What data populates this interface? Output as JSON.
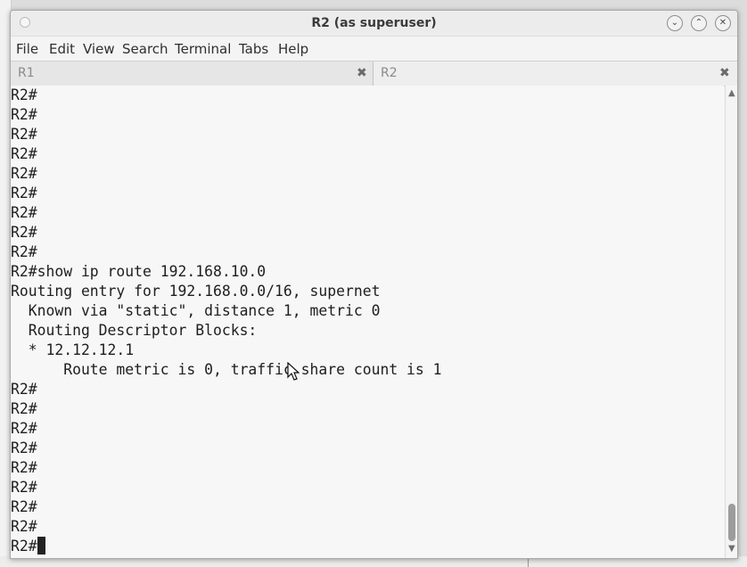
{
  "window": {
    "title": "R2 (as superuser)"
  },
  "menu": [
    "File",
    "Edit",
    "View",
    "Search",
    "Terminal",
    "Tabs",
    "Help"
  ],
  "tabs": [
    {
      "label": "R1",
      "close": "✖",
      "active": false
    },
    {
      "label": "R2",
      "close": "✖",
      "active": true
    }
  ],
  "terminal": {
    "lines": [
      "R2#",
      "R2#",
      "R2#",
      "R2#",
      "R2#",
      "R2#",
      "R2#",
      "R2#",
      "R2#",
      "R2#show ip route 192.168.10.0",
      "Routing entry for 192.168.0.0/16, supernet",
      "  Known via \"static\", distance 1, metric 0",
      "  Routing Descriptor Blocks:",
      "  * 12.12.12.1",
      "      Route metric is 0, traffic share count is 1",
      "R2#",
      "R2#",
      "R2#",
      "R2#",
      "R2#",
      "R2#",
      "R2#",
      "R2#",
      "R2#"
    ]
  },
  "colors": {
    "terminal_bg": "#f7f7f7",
    "terminal_fg": "#1e1e1e"
  },
  "icons": {
    "minimize": "minimize-icon",
    "maximize": "maximize-icon",
    "close": "close-icon"
  }
}
